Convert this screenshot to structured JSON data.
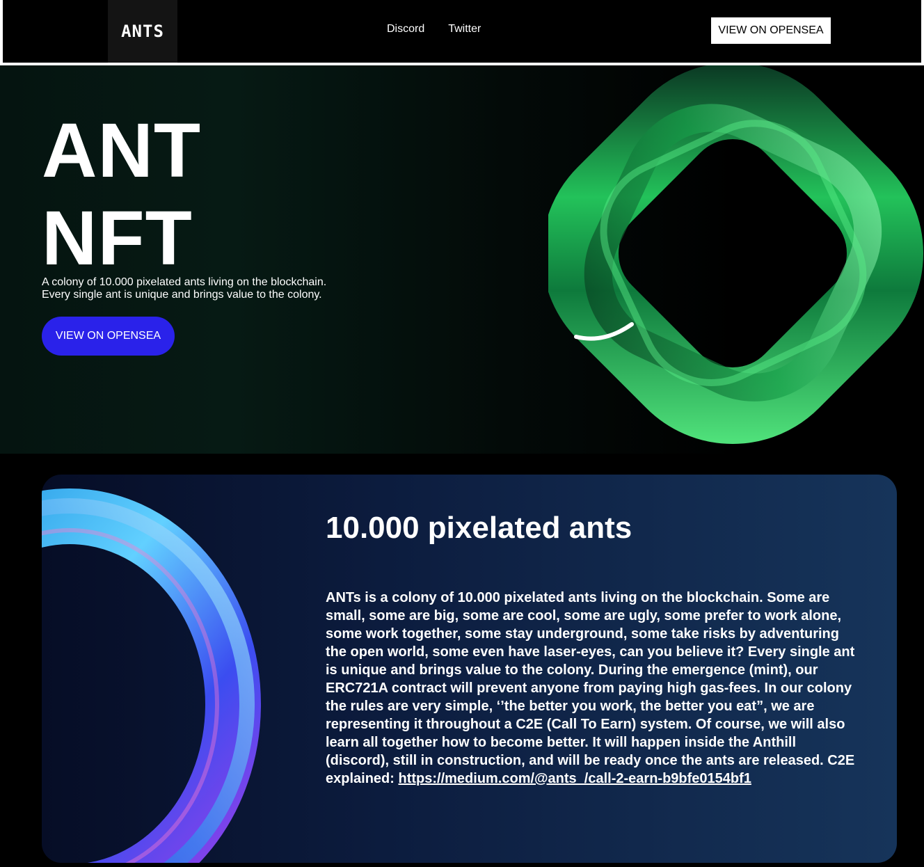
{
  "header": {
    "logo": "ANTS",
    "nav": [
      "Discord",
      "Twitter"
    ],
    "cta": "VIEW ON OPENSEA"
  },
  "hero": {
    "title_line1": "ANT",
    "title_line2": "NFT",
    "desc_line1": "A colony of 10.000 pixelated ants living on the blockchain.",
    "desc_line2": "Every single ant is unique and brings value to the colony.",
    "cta": "VIEW ON OPENSEA"
  },
  "info": {
    "title": "10.000 pixelated ants",
    "body": "ANTs is a colony of 10.000 pixelated ants living on the blockchain. Some are small, some are big, some are cool, some are ugly, some prefer to work alone, some work together, some stay underground, some take risks by adventuring the open world, some even have laser-eyes, can you believe it? Every single ant is unique and brings value to the colony. During the emergence (mint), our ERC721A contract will prevent anyone from paying high gas-fees. In our colony the rules are very simple, ‘’the better you work, the better you eat”, we are representing it throughout a C2E (Call To Earn) system. Of course, we will also learn all together how to become better. It will happen inside the Anthill (discord), still in construction, and will be ready once the ants are released. C2E explained: ",
    "link": "https://medium.com/@ants_/call-2-earn-b9bfe0154bf1"
  },
  "colors": {
    "accent_button": "#2a22ea",
    "torus_green": "#1fc45a",
    "torus_blue": "#3aa8ff"
  }
}
